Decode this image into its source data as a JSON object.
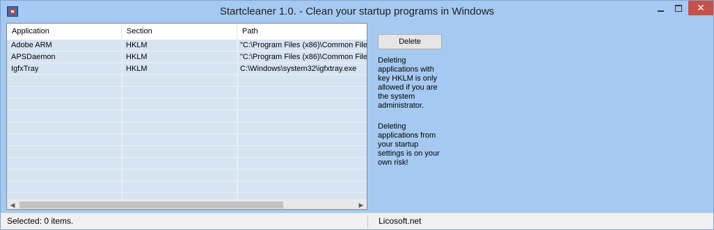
{
  "window": {
    "title": "Startcleaner 1.0.  - Clean your startup programs in Windows",
    "close_glyph": "✕"
  },
  "listview": {
    "columns": [
      "Application",
      "Section",
      "Path"
    ],
    "rows": [
      {
        "application": "Adobe ARM",
        "section": "HKLM",
        "path": "\"C:\\Program Files (x86)\\Common Files\\"
      },
      {
        "application": "APSDaemon",
        "section": "HKLM",
        "path": "\"C:\\Program Files (x86)\\Common Files\\"
      },
      {
        "application": "IgfxTray",
        "section": "HKLM",
        "path": "C:\\Windows\\system32\\igfxtray.exe"
      }
    ]
  },
  "actions": {
    "delete_label": "Delete"
  },
  "info": {
    "admin_note": "Deleting\napplications with\nkey HKLM is only\nallowed if you are\nthe system\nadministrator.",
    "risk_note": "Deleting\napplications from\nyour startup\nsettings is on your\nown risk!"
  },
  "status": {
    "selected_text": "Selected: 0 items.",
    "company": "Licosoft.net"
  },
  "colors": {
    "window_background": "#a5c9f0",
    "row_background": "#d6e4f2",
    "close_button": "#c7504a"
  },
  "icons": {
    "app": "startcleaner-app-icon",
    "scroll_left": "chevron-left-icon",
    "scroll_right": "chevron-right-icon"
  }
}
